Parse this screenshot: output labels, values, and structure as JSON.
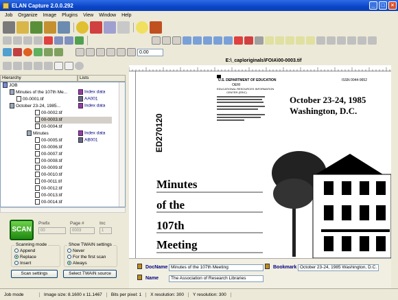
{
  "window": {
    "title": "ELAN Capture 2.0.0.292"
  },
  "menu": [
    "Job",
    "Organize",
    "Image",
    "Plugins",
    "View",
    "Window",
    "Help"
  ],
  "toolbar": {
    "zoom_value": "0.00"
  },
  "hierarchy": {
    "header_hierarchy": "Hierarchy",
    "header_lists": "Lists",
    "rows": [
      {
        "label": "JOB",
        "list": ""
      },
      {
        "label": "Minutes of the 107th Me...",
        "list": "Index data"
      },
      {
        "label": "00-0001.tif",
        "list": "AA001"
      },
      {
        "label": "October 23-24, 1985...",
        "list": "Index data"
      },
      {
        "label": "00-0002.tif",
        "list": ""
      },
      {
        "label": "00-0003.tif",
        "list": ""
      },
      {
        "label": "00-0004.tif",
        "list": ""
      },
      {
        "label": "Minutes",
        "list": "Index data"
      },
      {
        "label": "00-0005.tif",
        "list": "AB001"
      },
      {
        "label": "00-0006.tif",
        "list": ""
      },
      {
        "label": "00-0007.tif",
        "list": ""
      },
      {
        "label": "00-0008.tif",
        "list": ""
      },
      {
        "label": "00-0009.tif",
        "list": ""
      },
      {
        "label": "00-0010.tif",
        "list": ""
      },
      {
        "label": "00-0011.tif",
        "list": ""
      },
      {
        "label": "00-0012.tif",
        "list": ""
      },
      {
        "label": "00-0013.tif",
        "list": ""
      },
      {
        "label": "00-0014.tif",
        "list": ""
      }
    ]
  },
  "scan": {
    "button": "SCAN",
    "prefix_label": "Prefix",
    "prefix_value": "00",
    "page_label": "Page #",
    "page_value": "0003",
    "inc_label": "Inc",
    "inc_value": "1",
    "scanning_mode_title": "Scanning mode",
    "modes": [
      "Append",
      "Replace",
      "Insert"
    ],
    "twain_title": "Show TWAIN settings",
    "twain_options": [
      "Never",
      "For the first scan",
      "Always"
    ],
    "scan_settings_button": "Scan settings",
    "select_twain_button": "Select TWAIN source"
  },
  "document": {
    "path": "E:\\_cap\\originals\\FOIA\\00-0003.tif",
    "issn": "ISSN 0044-9652",
    "header_block": [
      "U.S. DEPARTMENT OF EDUCATION",
      "OERI",
      "EDUCATIONAL RESOURCES INFORMATION",
      "CENTER (ERIC)"
    ],
    "date_line1": "October 23-24, 1985",
    "date_line2": "Washington, D.C.",
    "ed_number": "ED270120",
    "minutes_lines": [
      "Minutes",
      "of the",
      "107th",
      "Meeting"
    ]
  },
  "index": {
    "docname_label": "DocName",
    "docname_value": "Minutes of the 107th Meeting",
    "name_label": "Name",
    "name_value": "The Association of Research Libraries",
    "bookmark_label": "Bookmark",
    "bookmark_value": "October 23-24, 1985 Washington, D.C."
  },
  "status": {
    "mode": "Job mode",
    "image_size": "Image size: 8.1600 x 11.1467",
    "bits": "Bits per pixel: 1",
    "xres": "X resolution: 300",
    "yres": "Y resolution: 300"
  }
}
